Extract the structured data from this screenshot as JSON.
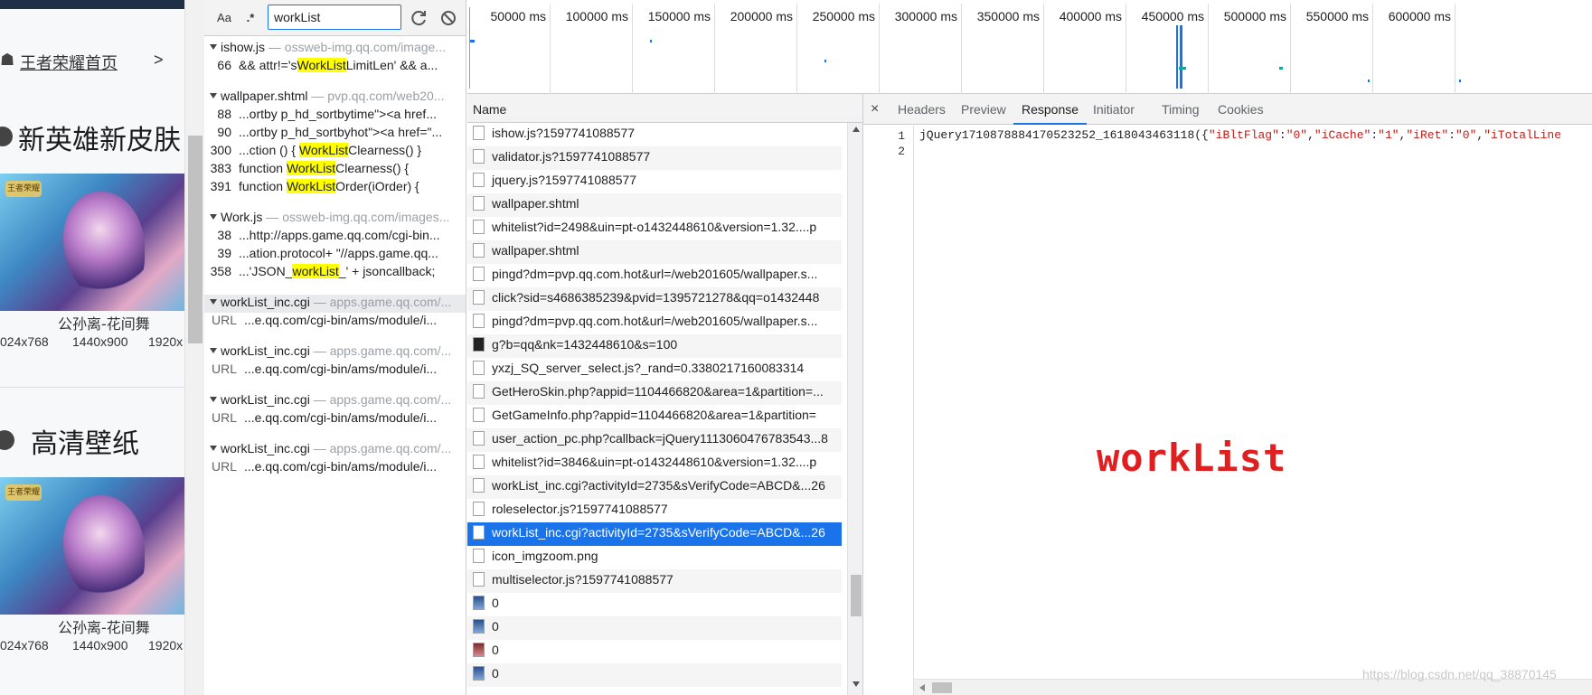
{
  "webpage": {
    "home_link": "王者荣耀首页",
    "home_arrow": ">",
    "section1_title": "新英雄新皮肤",
    "section2_title": "高清壁纸",
    "caption1": "公孙离-花间舞",
    "caption2": "公孙离-花间舞",
    "logo_text": "王者荣耀",
    "resolutions1": [
      "024x768",
      "1440x900",
      "1920x"
    ],
    "resolutions2": [
      "024x768",
      "1440x900",
      "1920x"
    ]
  },
  "search": {
    "match_case_label": "Aa",
    "regex_label": ".*",
    "query": "workList",
    "groups": [
      {
        "file": "ishow.js",
        "url": " — ossweb-img.qq.com/image...",
        "rows": [
          {
            "line": "66",
            "pre": "&& attr!='s",
            "hl": "WorkList",
            "post": "LimitLen' && a..."
          }
        ]
      },
      {
        "file": "wallpaper.shtml",
        "url": " — pvp.qq.com/web20...",
        "rows": [
          {
            "line": "88",
            "pre": "...ortby p_hd_sortbytime\"><a href...",
            "hl": "",
            "post": ""
          },
          {
            "line": "90",
            "pre": "...ortby p_hd_sortbyhot\"><a href=\"...",
            "hl": "",
            "post": ""
          },
          {
            "line": "300",
            "pre": "...ction () { ",
            "hl": "WorkList",
            "post": "Clearness() }"
          },
          {
            "line": "383",
            "pre": "function ",
            "hl": "WorkList",
            "post": "Clearness() {"
          },
          {
            "line": "391",
            "pre": "function ",
            "hl": "WorkList",
            "post": "Order(iOrder) {"
          }
        ]
      },
      {
        "file": "Work.js",
        "url": " — ossweb-img.qq.com/images...",
        "rows": [
          {
            "line": "38",
            "pre": "...http://apps.game.qq.com/cgi-bin...",
            "hl": "",
            "post": ""
          },
          {
            "line": "39",
            "pre": "...ation.protocol+ \"//apps.game.qq...",
            "hl": "",
            "post": ""
          },
          {
            "line": "358",
            "pre": "...'JSON_",
            "hl": "workList",
            "post": "_' + jsoncallback;"
          }
        ]
      },
      {
        "file": "workList_inc.cgi",
        "url": " — apps.game.qq.com/...",
        "rows": [
          {
            "line": "URL",
            "pre": "...e.qq.com/cgi-bin/ams/module/i...",
            "hl": "",
            "post": ""
          }
        ]
      },
      {
        "file": "workList_inc.cgi",
        "url": " — apps.game.qq.com/...",
        "rows": [
          {
            "line": "URL",
            "pre": "...e.qq.com/cgi-bin/ams/module/i...",
            "hl": "",
            "post": ""
          }
        ]
      },
      {
        "file": "workList_inc.cgi",
        "url": " — apps.game.qq.com/...",
        "rows": [
          {
            "line": "URL",
            "pre": "...e.qq.com/cgi-bin/ams/module/i...",
            "hl": "",
            "post": ""
          }
        ]
      },
      {
        "file": "workList_inc.cgi",
        "url": " — apps.game.qq.com/...",
        "rows": [
          {
            "line": "URL",
            "pre": "...e.qq.com/cgi-bin/ams/module/i...",
            "hl": "",
            "post": ""
          }
        ]
      }
    ]
  },
  "overview": {
    "ticks": [
      "50000 ms",
      "100000 ms",
      "150000 ms",
      "200000 ms",
      "250000 ms",
      "300000 ms",
      "350000 ms",
      "400000 ms",
      "450000 ms",
      "500000 ms",
      "550000 ms",
      "600000 ms"
    ]
  },
  "requests": {
    "column_name": "Name",
    "items": [
      {
        "name": "ishow.js?1597741088577",
        "icon": "doc"
      },
      {
        "name": "validator.js?1597741088577",
        "icon": "doc"
      },
      {
        "name": "jquery.js?1597741088577",
        "icon": "doc"
      },
      {
        "name": "wallpaper.shtml",
        "icon": "doc"
      },
      {
        "name": "whitelist?id=2498&uin=pt-o1432448610&version=1.32....p",
        "icon": "doc"
      },
      {
        "name": "wallpaper.shtml",
        "icon": "doc"
      },
      {
        "name": "pingd?dm=pvp.qq.com.hot&url=/web201605/wallpaper.s...",
        "icon": "doc"
      },
      {
        "name": "click?sid=s4686385239&pvid=1395721278&qq=o1432448",
        "icon": "doc"
      },
      {
        "name": "pingd?dm=pvp.qq.com.hot&url=/web201605/wallpaper.s...",
        "icon": "doc"
      },
      {
        "name": "g?b=qq&nk=1432448610&s=100",
        "icon": "dark"
      },
      {
        "name": "yxzj_SQ_server_select.js?_rand=0.3380217160083314",
        "icon": "doc"
      },
      {
        "name": "GetHeroSkin.php?appid=1104466820&area=1&partition=...",
        "icon": "doc"
      },
      {
        "name": "GetGameInfo.php?appid=1104466820&area=1&partition=",
        "icon": "doc"
      },
      {
        "name": "user_action_pc.php?callback=jQuery1113060476783543...8",
        "icon": "doc"
      },
      {
        "name": "whitelist?id=3846&uin=pt-o1432448610&version=1.32....p",
        "icon": "doc"
      },
      {
        "name": "workList_inc.cgi?activityId=2735&sVerifyCode=ABCD&...26",
        "icon": "doc"
      },
      {
        "name": "roleselector.js?1597741088577",
        "icon": "doc"
      },
      {
        "name": "workList_inc.cgi?activityId=2735&sVerifyCode=ABCD&...26",
        "icon": "doc",
        "selected": true
      },
      {
        "name": "icon_imgzoom.png",
        "icon": "doc"
      },
      {
        "name": "multiselector.js?1597741088577",
        "icon": "doc"
      },
      {
        "name": "0",
        "icon": "img"
      },
      {
        "name": "0",
        "icon": "img"
      },
      {
        "name": "0",
        "icon": "img2"
      },
      {
        "name": "0",
        "icon": "img"
      }
    ]
  },
  "detail": {
    "close_glyph": "×",
    "tabs": [
      "Headers",
      "Preview",
      "Response",
      "Initiator",
      "Timing",
      "Cookies"
    ],
    "active_tab": "Response",
    "line_numbers": [
      "1",
      "2"
    ],
    "response_prefix": "jQuery1710878884170523252_1618043463118({",
    "response_pairs": [
      {
        "k": "\"iBltFlag\"",
        "v": "\"0\""
      },
      {
        "k": "\"iCache\"",
        "v": "\"1\""
      },
      {
        "k": "\"iRet\"",
        "v": "\"0\""
      },
      {
        "k": "\"iTotalLine",
        "v": ""
      }
    ],
    "overlay_text": "workList",
    "watermark": "https://blog.csdn.net/qq_38870145"
  },
  "colors": {
    "accent": "#1a73e8",
    "highlight": "#ffff00",
    "overlay": "#e02020"
  }
}
